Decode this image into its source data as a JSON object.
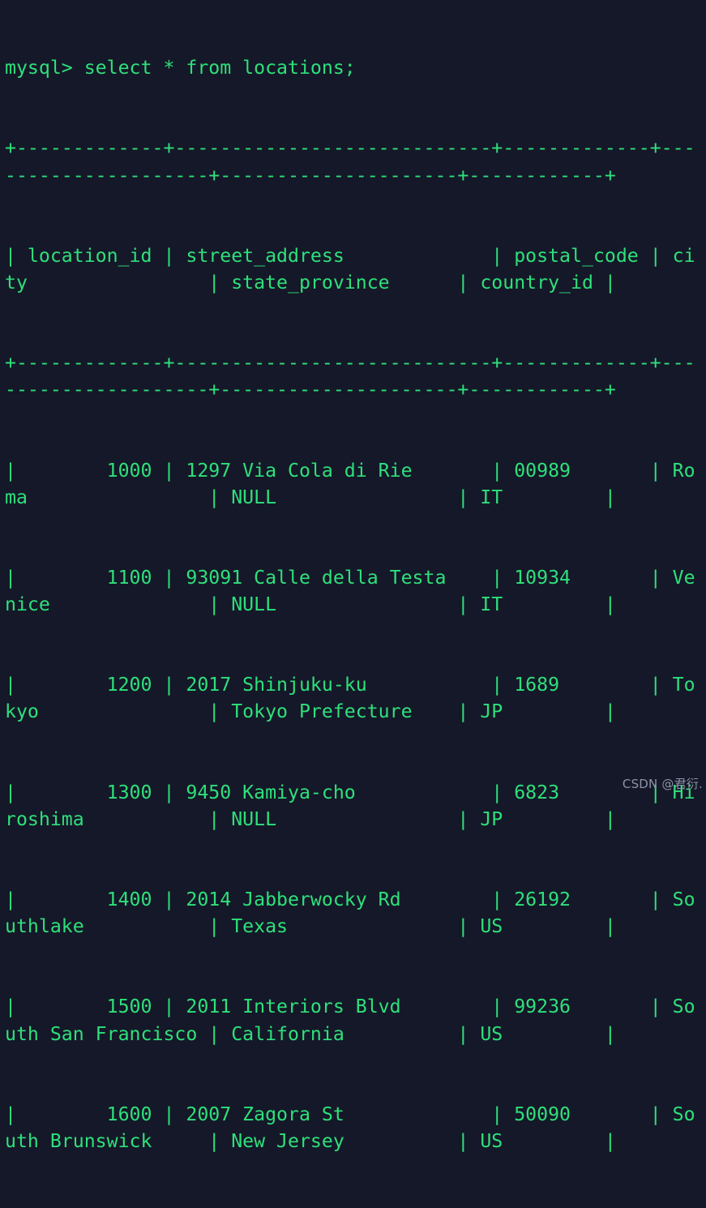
{
  "terminal": {
    "background_color": "#151829",
    "text_color": "#2ee07a",
    "watermark_color": "#8d93a6",
    "prompt": "mysql> ",
    "command": "select * from locations;",
    "prompt_line": "mysql> select * from locations;",
    "separator": "+-------------+----------------------------+-------------+---------------------+---------------------+------------+",
    "header_line": "| location_id | street_address             | postal_code | city                | state_province      | country_id |",
    "columns": [
      "location_id",
      "street_address",
      "postal_code",
      "city",
      "state_province",
      "country_id"
    ],
    "rows": [
      {
        "location_id": "1000",
        "street_address": "1297 Via Cola di Rie",
        "postal_code": "00989",
        "city": "Roma",
        "state_province": "NULL",
        "country_id": "IT",
        "line": "|        1000 | 1297 Via Cola di Rie       | 00989       | Roma                | NULL                | IT         |"
      },
      {
        "location_id": "1100",
        "street_address": "93091 Calle della Testa",
        "postal_code": "10934",
        "city": "Venice",
        "state_province": "NULL",
        "country_id": "IT",
        "line": "|        1100 | 93091 Calle della Testa    | 10934       | Venice              | NULL                | IT         |"
      },
      {
        "location_id": "1200",
        "street_address": "2017 Shinjuku-ku",
        "postal_code": "1689",
        "city": "Tokyo",
        "state_province": "Tokyo Prefecture",
        "country_id": "JP",
        "line": "|        1200 | 2017 Shinjuku-ku           | 1689        | Tokyo               | Tokyo Prefecture    | JP         |"
      },
      {
        "location_id": "1300",
        "street_address": "9450 Kamiya-cho",
        "postal_code": "6823",
        "city": "Hiroshima",
        "state_province": "NULL",
        "country_id": "JP",
        "line": "|        1300 | 9450 Kamiya-cho            | 6823        | Hiroshima           | NULL                | JP         |"
      },
      {
        "location_id": "1400",
        "street_address": "2014 Jabberwocky Rd",
        "postal_code": "26192",
        "city": "Southlake",
        "state_province": "Texas",
        "country_id": "US",
        "line": "|        1400 | 2014 Jabberwocky Rd        | 26192       | Southlake           | Texas               | US         |"
      },
      {
        "location_id": "1500",
        "street_address": "2011 Interiors Blvd",
        "postal_code": "99236",
        "city": "South San Francisco",
        "state_province": "California",
        "country_id": "US",
        "line": "|        1500 | 2011 Interiors Blvd        | 99236       | South San Francisco | California          | US         |"
      },
      {
        "location_id": "1600",
        "street_address": "2007 Zagora St",
        "postal_code": "50090",
        "city": "South Brunswick",
        "state_province": "New Jersey",
        "country_id": "US",
        "line": "|        1600 | 2007 Zagora St             | 50090       | South Brunswick     | New Jersey          | US         |"
      }
    ],
    "watermark": "CSDN @君衍."
  }
}
